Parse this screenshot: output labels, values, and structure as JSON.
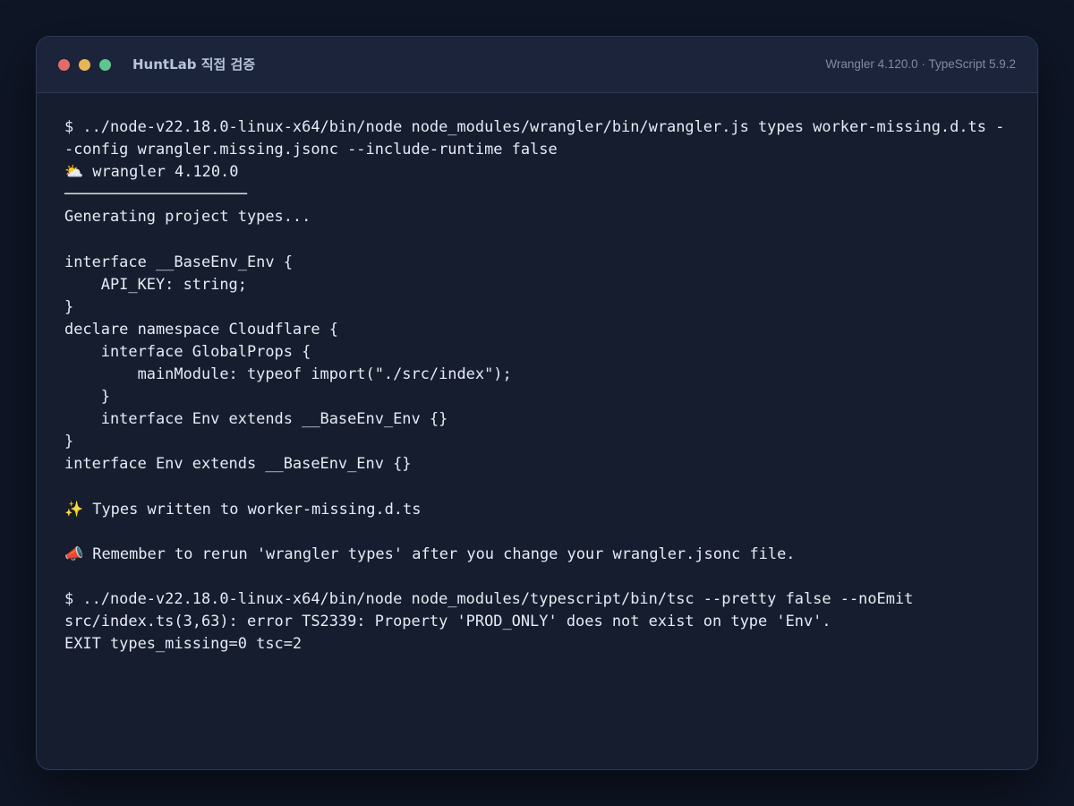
{
  "window": {
    "title": "HuntLab 직접 검증",
    "version": "Wrangler 4.120.0 · TypeScript 5.9.2"
  },
  "terminal": {
    "lines": [
      "$ ../node-v22.18.0-linux-x64/bin/node node_modules/wrangler/bin/wrangler.js types worker-missing.d.ts -",
      "-config wrangler.missing.jsonc --include-runtime false",
      "⛅️ wrangler 4.120.0",
      "────────────────────",
      "Generating project types...",
      "",
      "interface __BaseEnv_Env {",
      "    API_KEY: string;",
      "}",
      "declare namespace Cloudflare {",
      "    interface GlobalProps {",
      "        mainModule: typeof import(\"./src/index\");",
      "    }",
      "    interface Env extends __BaseEnv_Env {}",
      "}",
      "interface Env extends __BaseEnv_Env {}",
      "",
      "✨ Types written to worker-missing.d.ts",
      "",
      "📣 Remember to rerun 'wrangler types' after you change your wrangler.jsonc file.",
      "",
      "$ ../node-v22.18.0-linux-x64/bin/node node_modules/typescript/bin/tsc --pretty false --noEmit",
      "src/index.ts(3,63): error TS2339: Property 'PROD_ONLY' does not exist on type 'Env'.",
      "EXIT types_missing=0 tsc=2"
    ]
  }
}
